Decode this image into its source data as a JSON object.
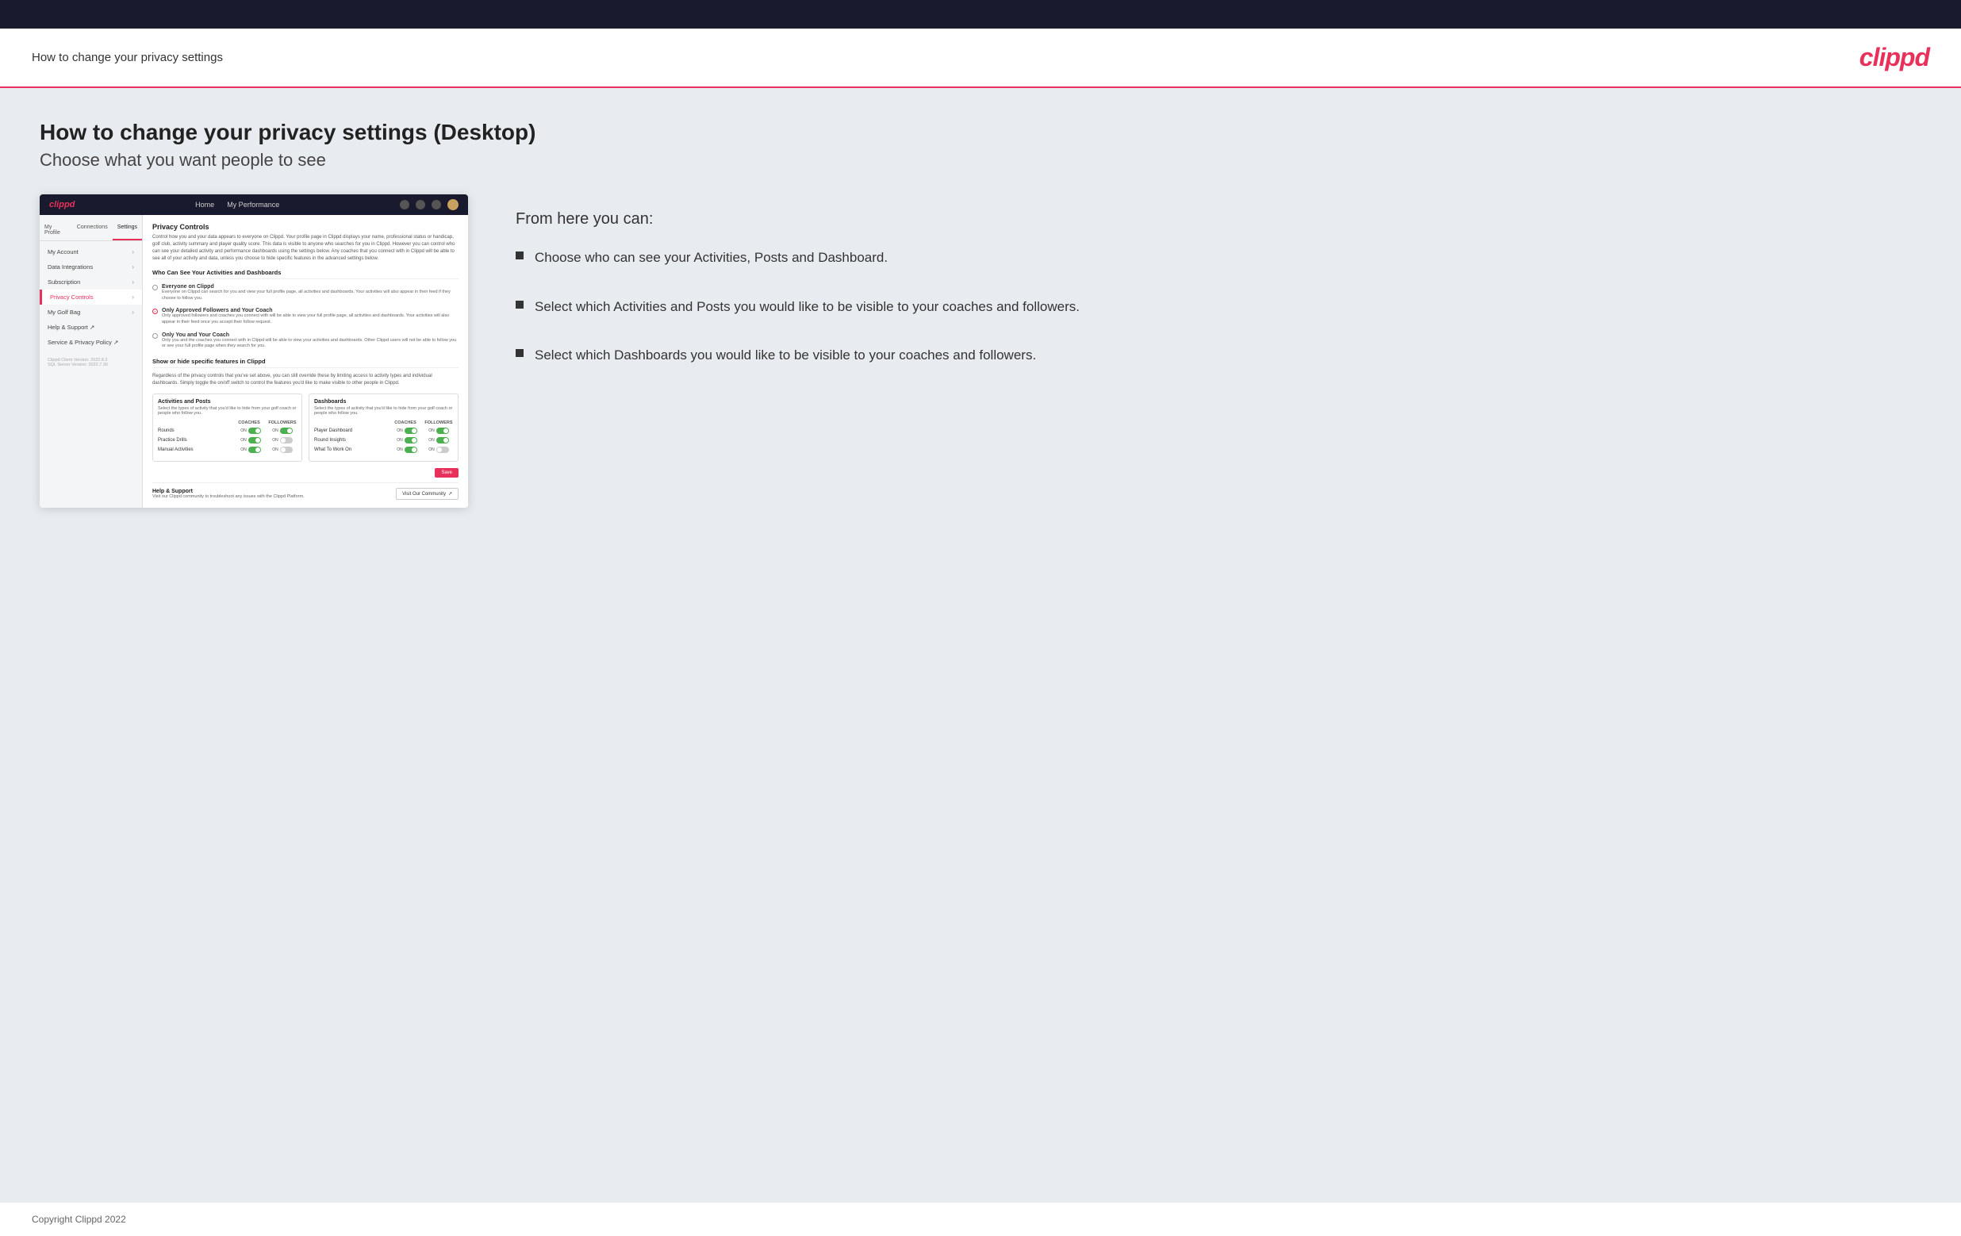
{
  "header": {
    "title": "How to change your privacy settings",
    "logo": "clippd"
  },
  "page": {
    "heading": "How to change your privacy settings (Desktop)",
    "subheading": "Choose what you want people to see"
  },
  "app_screenshot": {
    "nav": {
      "logo": "clippd",
      "links": [
        "Home",
        "My Performance"
      ],
      "icons": [
        "search",
        "grid",
        "settings",
        "avatar"
      ]
    },
    "sidebar": {
      "tabs": [
        "My Profile",
        "Connections",
        "Settings"
      ],
      "active_tab": "Settings",
      "items": [
        {
          "label": "My Account",
          "active": false
        },
        {
          "label": "Data Integrations",
          "active": false
        },
        {
          "label": "Subscription",
          "active": false
        },
        {
          "label": "Privacy Controls",
          "active": true
        },
        {
          "label": "My Golf Bag",
          "active": false
        },
        {
          "label": "Help & Support",
          "has_icon": true,
          "active": false
        },
        {
          "label": "Service & Privacy Policy",
          "has_icon": true,
          "active": false
        }
      ],
      "version": "Clippd Client Version: 2022.8.2\nSQL Server Version: 2022.7.30"
    },
    "main": {
      "privacy_title": "Privacy Controls",
      "privacy_desc": "Control how you and your data appears to everyone on Clippd. Your profile page in Clippd displays your name, professional status or handicap, golf club, activity summary and player quality score. This data is visible to anyone who searches for you in Clippd. However you can control who can see your detailed activity and performance dashboards using the settings below. Any coaches that you connect with in Clippd will be able to see all of your activity and data, unless you choose to hide specific features in the advanced settings below.",
      "who_section_title": "Who Can See Your Activities and Dashboards",
      "options": [
        {
          "label": "Everyone on Clippd",
          "desc": "Everyone on Clippd can search for you and view your full profile page, all activities and dashboards. Your activities will also appear in their feed if they choose to follow you.",
          "selected": false
        },
        {
          "label": "Only Approved Followers and Your Coach",
          "desc": "Only approved followers and coaches you connect with will be able to view your full profile page, all activities and dashboards. Your activities will also appear in their feed once you accept their follow request.",
          "selected": true
        },
        {
          "label": "Only You and Your Coach",
          "desc": "Only you and the coaches you connect with in Clippd will be able to view your activities and dashboards. Other Clippd users will not be able to follow you or see your full profile page when they search for you.",
          "selected": false
        }
      ],
      "show_hide_title": "Show or hide specific features in Clippd",
      "show_hide_desc": "Regardless of the privacy controls that you've set above, you can still override these by limiting access to activity types and individual dashboards. Simply toggle the on/off switch to control the features you'd like to make visible to other people in Clippd.",
      "activities_panel": {
        "title": "Activities and Posts",
        "desc": "Select the types of activity that you'd like to hide from your golf coach or people who follow you.",
        "col_labels": [
          "COACHES",
          "FOLLOWERS"
        ],
        "rows": [
          {
            "name": "Rounds",
            "coaches_on": true,
            "followers_on": true
          },
          {
            "name": "Practice Drills",
            "coaches_on": true,
            "followers_on": false
          },
          {
            "name": "Manual Activities",
            "coaches_on": true,
            "followers_on": false
          }
        ]
      },
      "dashboards_panel": {
        "title": "Dashboards",
        "desc": "Select the types of activity that you'd like to hide from your golf coach or people who follow you.",
        "col_labels": [
          "COACHES",
          "FOLLOWERS"
        ],
        "rows": [
          {
            "name": "Player Dashboard",
            "coaches_on": true,
            "followers_on": true
          },
          {
            "name": "Round Insights",
            "coaches_on": true,
            "followers_on": true
          },
          {
            "name": "What To Work On",
            "coaches_on": true,
            "followers_on": false
          }
        ]
      },
      "save_label": "Save",
      "help_section": {
        "title": "Help & Support",
        "desc": "Visit our Clippd community to troubleshoot any issues with the Clippd Platform.",
        "button_label": "Visit Our Community"
      }
    }
  },
  "right_panel": {
    "from_here": "From here you can:",
    "bullets": [
      "Choose who can see your Activities, Posts and Dashboard.",
      "Select which Activities and Posts you would like to be visible to your coaches and followers.",
      "Select which Dashboards you would like to be visible to your coaches and followers."
    ]
  },
  "footer": {
    "copyright": "Copyright Clippd 2022"
  }
}
